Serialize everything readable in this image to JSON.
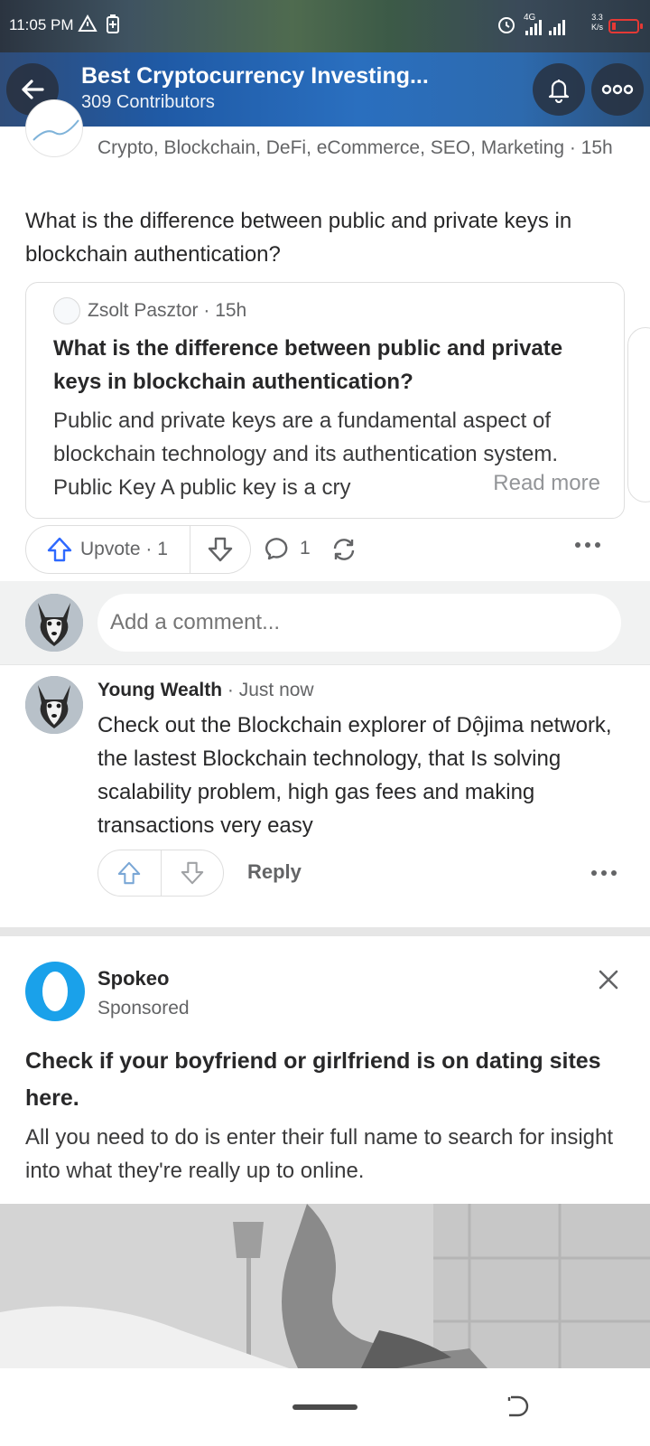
{
  "status_bar": {
    "time": "11:05 PM",
    "network": "4G",
    "speed_top": "3.3",
    "speed_bottom": "K/s"
  },
  "header": {
    "title": "Best Cryptocurrency Investing...",
    "subtitle": "309 Contributors"
  },
  "post": {
    "author_meta": "Crypto, Blockchain, DeFi, eCommerce, SEO, Marketing · 15h",
    "question": "What is the difference between public and private keys in blockchain authentication?",
    "shared_answer": {
      "author": "Zsolt Pasztor · 15h",
      "title": "What is the difference between public and private keys in blockchain authentication?",
      "body": "Public and private keys are a fundamental aspect of blockchain technology and its authentication system. Public Key A public key is a cry",
      "read_more": "Read more"
    },
    "actions": {
      "upvote_label": "Upvote · 1",
      "comment_count": "1"
    }
  },
  "comment_input": {
    "placeholder": "Add a comment..."
  },
  "comment": {
    "author": "Young Wealth",
    "time": " · Just now",
    "text": "Check out the Blockchain explorer of Dộjima network, the lastest Blockchain technology, that Is solving scalability problem, high gas fees and making transactions very easy",
    "reply_label": "Reply"
  },
  "ad": {
    "brand": "Spokeo",
    "sponsored": "Sponsored",
    "title": "Check if your boyfriend or girlfriend is on dating sites here.",
    "text": "All you need to do is enter their full name to search for insight into what they're really up to online.",
    "brand_color": "#1aa1ea"
  },
  "colors": {
    "accent_blue": "#2e69ff",
    "text_primary": "#282829",
    "text_secondary": "#636466"
  }
}
